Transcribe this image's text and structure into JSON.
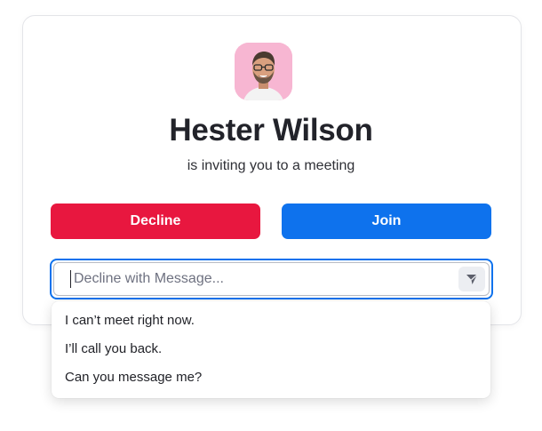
{
  "caller": {
    "name": "Hester Wilson",
    "subtitle": "is inviting you to a meeting",
    "avatar_icon": "person-photo-avatar"
  },
  "actions": {
    "decline_label": "Decline",
    "join_label": "Join"
  },
  "message": {
    "placeholder": "Decline with Message...",
    "value": "",
    "send_icon": "send-arrow-icon"
  },
  "quick_replies": [
    {
      "label": "I can’t meet right now."
    },
    {
      "label": "I’ll call you back."
    },
    {
      "label": "Can you message me?"
    }
  ],
  "colors": {
    "decline": "#e8173f",
    "join": "#0e72ed",
    "avatar_bg": "#f7b6d2",
    "focus_border": "#0e72ed"
  }
}
